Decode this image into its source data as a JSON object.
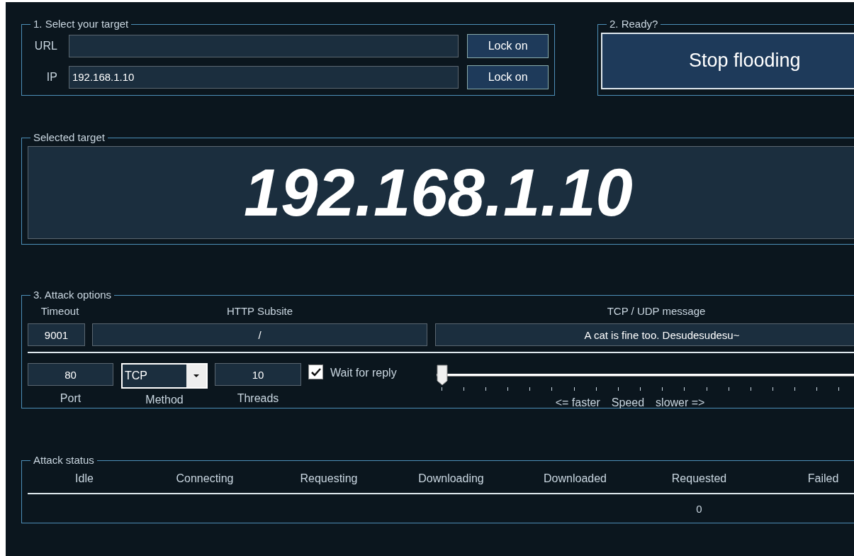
{
  "target": {
    "title": "1. Select your target",
    "url_label": "URL",
    "ip_label": "IP",
    "ip_value": "192.168.1.10",
    "lock_buttons": [
      "Lock on",
      "Lock on"
    ]
  },
  "ready": {
    "title": "2. Ready?",
    "button": "Stop flooding"
  },
  "selected": {
    "title": "Selected target",
    "value": "192.168.1.10"
  },
  "options": {
    "title": "3. Attack options",
    "timeout_label": "Timeout",
    "timeout": "9001",
    "subsite_label": "HTTP Subsite",
    "subsite": "/",
    "message_label": "TCP / UDP message",
    "message": "A cat is fine too. Desudesudesu~",
    "port": "80",
    "port_label": "Port",
    "method": "TCP",
    "method_label": "Method",
    "threads": "10",
    "threads_label": "Threads",
    "wait_label": "Wait for reply",
    "wait_checked": true,
    "speed": {
      "level": 0,
      "faster": "<= faster",
      "label": "Speed",
      "slower": "slower =>"
    }
  },
  "status": {
    "title": "Attack status",
    "columns": [
      {
        "label": "Idle"
      },
      {
        "label": "Connecting"
      },
      {
        "label": "Requesting"
      },
      {
        "label": "Downloading"
      },
      {
        "label": "Downloaded"
      },
      {
        "label": "Requested",
        "value": "0"
      },
      {
        "label": "Failed"
      }
    ]
  }
}
